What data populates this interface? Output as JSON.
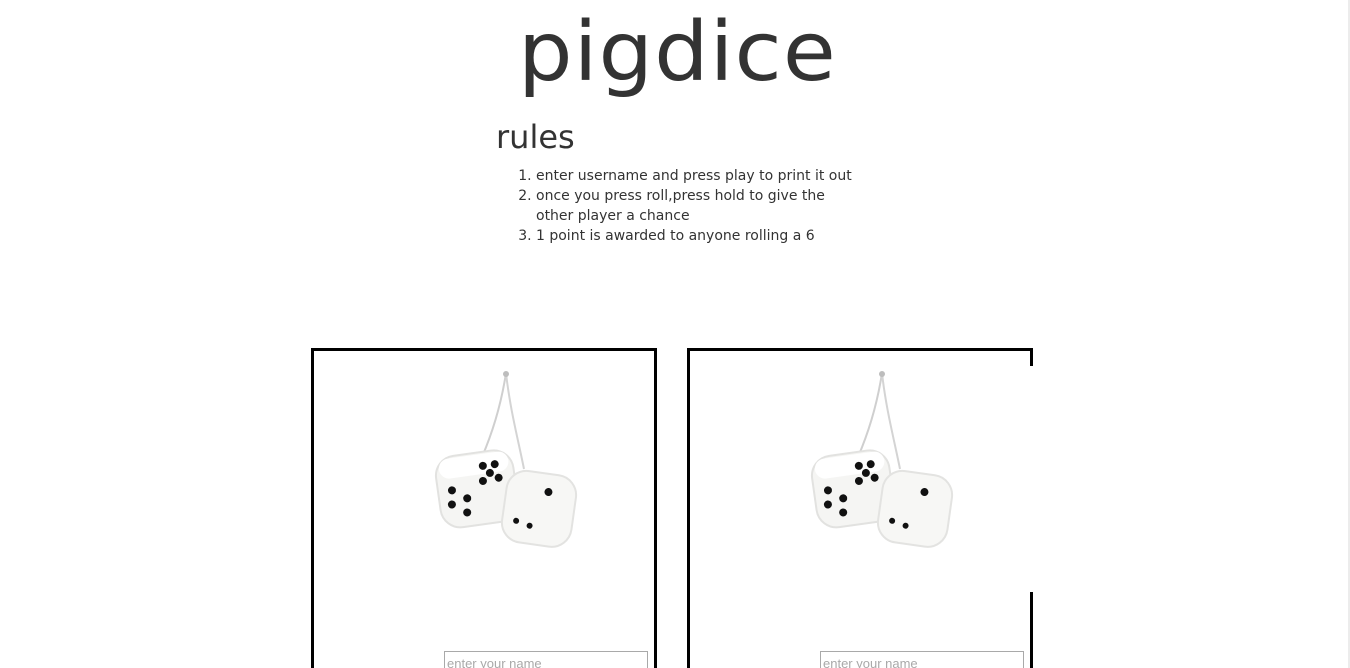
{
  "app": {
    "title": "pigdice"
  },
  "rules": {
    "heading": "rules",
    "items": [
      "enter username and press play to print it out",
      "once you press roll,press hold to give the other player a chance",
      "1 point is awarded to anyone rolling a 6"
    ]
  },
  "players": [
    {
      "name_placeholder": "enter your name",
      "name_value": "",
      "image_icon": "fuzzy-dice-icon"
    },
    {
      "name_placeholder": "enter your name",
      "name_value": "",
      "image_icon": "fuzzy-dice-icon"
    }
  ],
  "colors": {
    "text": "#333333",
    "card_border": "#000000",
    "dice_white": "#f5f5f3",
    "pips": "#111111"
  }
}
